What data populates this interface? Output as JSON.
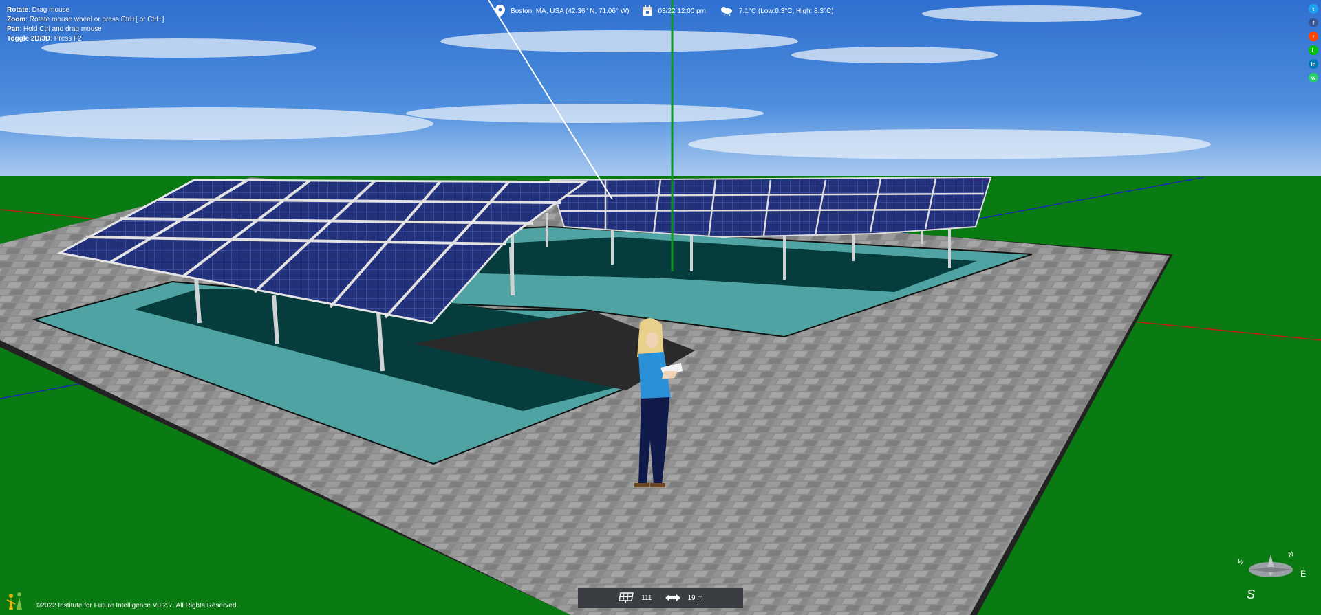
{
  "help": {
    "rotate_label": "Rotate",
    "rotate_text": ": Drag mouse",
    "zoom_label": "Zoom",
    "zoom_text": ": Rotate mouse wheel or press Ctrl+[ or Ctrl+]",
    "pan_label": "Pan",
    "pan_text": ": Hold Ctrl and drag mouse",
    "toggle_label": "Toggle 2D/3D",
    "toggle_text": ": Press F2"
  },
  "info": {
    "location": "Boston, MA, USA (42.36° N, 71.06° W)",
    "datetime": "03/22 12:00 pm",
    "weather": "7.1°C (Low:0.3°C, High: 8.3°C)"
  },
  "social": [
    "twitter-icon",
    "facebook-icon",
    "reddit-icon",
    "line-icon",
    "linkedin-icon",
    "whatsapp-icon"
  ],
  "footer": {
    "copyright": "©2022 Institute for Future Intelligence V0.2.7. All Rights Reserved."
  },
  "status": {
    "panel_count": "111",
    "distance": "19 m"
  },
  "compass": {
    "n": "N",
    "e": "E",
    "s": "S",
    "w": "W"
  },
  "colors": {
    "ground": "#0a7a12",
    "pavement": "#8a8a8a",
    "pad": "#4fa3a3",
    "panel": "#23307a",
    "statusbar": "#3a3d42"
  }
}
